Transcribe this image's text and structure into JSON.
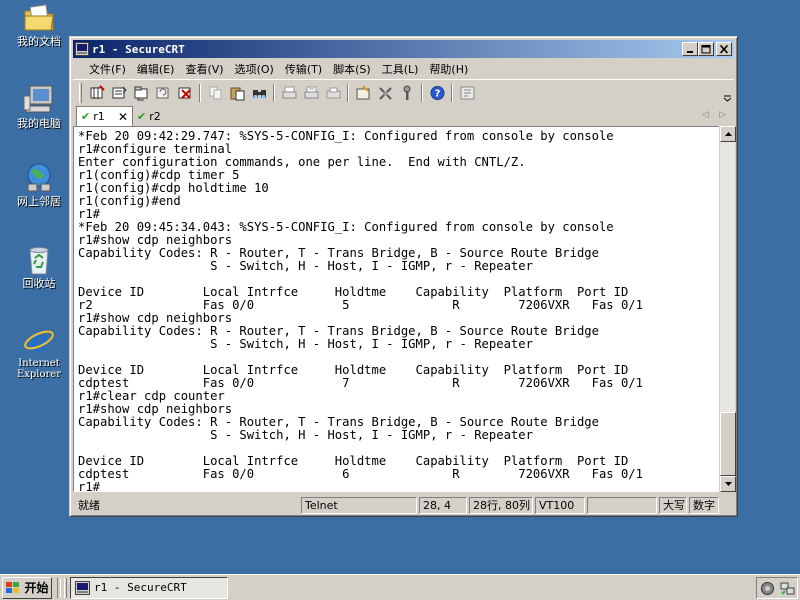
{
  "desktop": {
    "icons": [
      {
        "label": "我的文档",
        "icon": "folder-documents-icon"
      },
      {
        "label": "我的电脑",
        "icon": "computer-icon"
      },
      {
        "label": "网上邻居",
        "icon": "network-places-icon"
      },
      {
        "label": "回收站",
        "icon": "recycle-bin-icon"
      },
      {
        "label_line1": "Internet",
        "label_line2": "Explorer",
        "icon": "internet-explorer-icon"
      }
    ]
  },
  "window": {
    "title": "r1 - SecureCRT",
    "menu": [
      "文件(F)",
      "编辑(E)",
      "查看(V)",
      "选项(O)",
      "传输(T)",
      "脚本(S)",
      "工具(L)",
      "帮助(H)"
    ],
    "toolbar_icons": [
      "connect-icon",
      "quick-connect-icon",
      "connect-tab-icon",
      "reconnect-icon",
      "disconnect-icon",
      "copy-icon",
      "paste-icon",
      "find-icon",
      "print-icon",
      "print-selection-icon",
      "printer-icon",
      "session-options-icon",
      "global-options-icon",
      "keymap-icon",
      "help-icon",
      "script-icon"
    ],
    "tabs": [
      {
        "label": "r1",
        "active": true
      },
      {
        "label": "r2",
        "active": false
      }
    ],
    "terminal_lines": [
      "*Feb 20 09:42:29.747: %SYS-5-CONFIG_I: Configured from console by console",
      "r1#configure terminal",
      "Enter configuration commands, one per line.  End with CNTL/Z.",
      "r1(config)#cdp timer 5",
      "r1(config)#cdp holdtime 10",
      "r1(config)#end",
      "r1#",
      "*Feb 20 09:45:34.043: %SYS-5-CONFIG_I: Configured from console by console",
      "r1#show cdp neighbors",
      "Capability Codes: R - Router, T - Trans Bridge, B - Source Route Bridge",
      "                  S - Switch, H - Host, I - IGMP, r - Repeater",
      "",
      "Device ID        Local Intrfce     Holdtme    Capability  Platform  Port ID",
      "r2               Fas 0/0            5              R        7206VXR   Fas 0/1",
      "r1#show cdp neighbors",
      "Capability Codes: R - Router, T - Trans Bridge, B - Source Route Bridge",
      "                  S - Switch, H - Host, I - IGMP, r - Repeater",
      "",
      "Device ID        Local Intrfce     Holdtme    Capability  Platform  Port ID",
      "cdptest          Fas 0/0            7              R        7206VXR   Fas 0/1",
      "r1#clear cdp counter",
      "r1#show cdp neighbors",
      "Capability Codes: R - Router, T - Trans Bridge, B - Source Route Bridge",
      "                  S - Switch, H - Host, I - IGMP, r - Repeater",
      "",
      "Device ID        Local Intrfce     Holdtme    Capability  Platform  Port ID",
      "cdptest          Fas 0/0            6              R        7206VXR   Fas 0/1",
      "r1#"
    ],
    "status": {
      "ready": "就绪",
      "protocol": "Telnet",
      "cursor": "28,  4",
      "size": "28行, 80列",
      "emulation": "VT100",
      "blank": "",
      "caps": "大写",
      "num": "数字"
    }
  },
  "taskbar": {
    "start_label": "开始",
    "task_label": "r1 - SecureCRT"
  },
  "colors": {
    "desktop": "#3a6ea5",
    "title_start": "#0a246a",
    "title_end": "#a6caf0",
    "face": "#d4d0c8"
  }
}
